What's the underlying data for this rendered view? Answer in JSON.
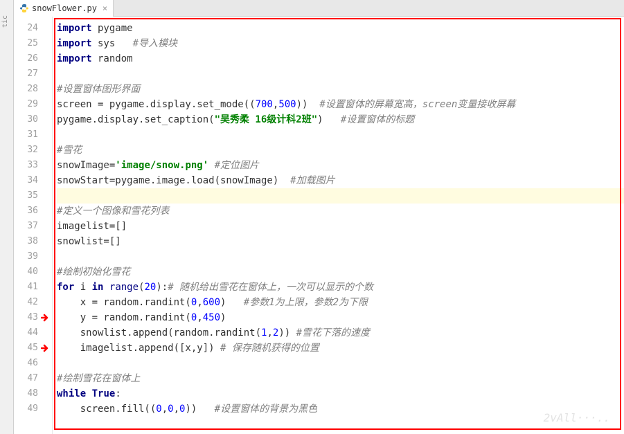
{
  "sidebar": {
    "label": "tic"
  },
  "tab": {
    "filename": "snowFlower.py"
  },
  "gutter": {
    "start": 24,
    "end": 49,
    "arrows": [
      43,
      45
    ]
  },
  "code": {
    "lines": [
      {
        "n": 24,
        "parts": [
          {
            "t": "import",
            "c": "kw"
          },
          {
            "t": " pygame",
            "c": ""
          }
        ]
      },
      {
        "n": 25,
        "parts": [
          {
            "t": "import",
            "c": "kw"
          },
          {
            "t": " sys   ",
            "c": ""
          },
          {
            "t": "#导入模块",
            "c": "com"
          }
        ]
      },
      {
        "n": 26,
        "parts": [
          {
            "t": "import",
            "c": "kw"
          },
          {
            "t": " random",
            "c": ""
          }
        ]
      },
      {
        "n": 27,
        "parts": []
      },
      {
        "n": 28,
        "parts": [
          {
            "t": "#设置窗体图形界面",
            "c": "com"
          }
        ]
      },
      {
        "n": 29,
        "parts": [
          {
            "t": "screen = pygame.display.set_mode((",
            "c": ""
          },
          {
            "t": "700",
            "c": "num"
          },
          {
            "t": ",",
            "c": ""
          },
          {
            "t": "500",
            "c": "num"
          },
          {
            "t": "))  ",
            "c": ""
          },
          {
            "t": "#设置窗体的屏幕宽高，",
            "c": "com"
          },
          {
            "t": "screen",
            "c": "com-em"
          },
          {
            "t": "变量接收屏幕",
            "c": "com"
          }
        ]
      },
      {
        "n": 30,
        "parts": [
          {
            "t": "pygame.display.set_caption(",
            "c": ""
          },
          {
            "t": "\"吴秀柔 16级计科2班\"",
            "c": "str"
          },
          {
            "t": ")   ",
            "c": ""
          },
          {
            "t": "#设置窗体的标题",
            "c": "com"
          }
        ]
      },
      {
        "n": 31,
        "parts": []
      },
      {
        "n": 32,
        "parts": [
          {
            "t": "#雪花",
            "c": "com"
          }
        ]
      },
      {
        "n": 33,
        "parts": [
          {
            "t": "snowImage=",
            "c": ""
          },
          {
            "t": "'image/snow.png'",
            "c": "str"
          },
          {
            "t": " ",
            "c": ""
          },
          {
            "t": "#定位图片",
            "c": "com"
          }
        ]
      },
      {
        "n": 34,
        "parts": [
          {
            "t": "snowStart=pygame.image.load(snowImage)  ",
            "c": ""
          },
          {
            "t": "#加载图片",
            "c": "com"
          }
        ]
      },
      {
        "n": 35,
        "parts": [],
        "hl": true
      },
      {
        "n": 36,
        "parts": [
          {
            "t": "#定义一个图像和雪花列表",
            "c": "com"
          }
        ]
      },
      {
        "n": 37,
        "parts": [
          {
            "t": "imagelist=[]",
            "c": ""
          }
        ]
      },
      {
        "n": 38,
        "parts": [
          {
            "t": "snowlist=[]",
            "c": ""
          }
        ]
      },
      {
        "n": 39,
        "parts": []
      },
      {
        "n": 40,
        "parts": [
          {
            "t": "#绘制初始化雪花",
            "c": "com"
          }
        ]
      },
      {
        "n": 41,
        "parts": [
          {
            "t": "for",
            "c": "kw"
          },
          {
            "t": " i ",
            "c": ""
          },
          {
            "t": "in",
            "c": "kw"
          },
          {
            "t": " ",
            "c": ""
          },
          {
            "t": "range",
            "c": "builtin"
          },
          {
            "t": "(",
            "c": ""
          },
          {
            "t": "20",
            "c": "num"
          },
          {
            "t": "):",
            "c": ""
          },
          {
            "t": "# 随机给出雪花在窗体上，一次可以显示的个数",
            "c": "com"
          }
        ]
      },
      {
        "n": 42,
        "parts": [
          {
            "t": "    x = random.randint(",
            "c": ""
          },
          {
            "t": "0",
            "c": "num"
          },
          {
            "t": ",",
            "c": ""
          },
          {
            "t": "600",
            "c": "num"
          },
          {
            "t": ")   ",
            "c": ""
          },
          {
            "t": "#参数1为上限，参数2为下限",
            "c": "com"
          }
        ]
      },
      {
        "n": 43,
        "parts": [
          {
            "t": "    y = random.randint(",
            "c": ""
          },
          {
            "t": "0",
            "c": "num"
          },
          {
            "t": ",",
            "c": ""
          },
          {
            "t": "450",
            "c": "num"
          },
          {
            "t": ")",
            "c": ""
          }
        ]
      },
      {
        "n": 44,
        "parts": [
          {
            "t": "    snowlist.append(random.randint(",
            "c": ""
          },
          {
            "t": "1",
            "c": "num"
          },
          {
            "t": ",",
            "c": ""
          },
          {
            "t": "2",
            "c": "num"
          },
          {
            "t": ")) ",
            "c": ""
          },
          {
            "t": "#雪花下落的速度",
            "c": "com"
          }
        ]
      },
      {
        "n": 45,
        "parts": [
          {
            "t": "    imagelist.append([x,y]) ",
            "c": ""
          },
          {
            "t": "# 保存随机获得的位置",
            "c": "com"
          }
        ]
      },
      {
        "n": 46,
        "parts": []
      },
      {
        "n": 47,
        "parts": [
          {
            "t": "#绘制雪花在窗体上",
            "c": "com"
          }
        ]
      },
      {
        "n": 48,
        "parts": [
          {
            "t": "while",
            "c": "kw"
          },
          {
            "t": " ",
            "c": ""
          },
          {
            "t": "True",
            "c": "kw"
          },
          {
            "t": ":",
            "c": ""
          }
        ]
      },
      {
        "n": 49,
        "parts": [
          {
            "t": "    screen.fill((",
            "c": ""
          },
          {
            "t": "0",
            "c": "num"
          },
          {
            "t": ",",
            "c": ""
          },
          {
            "t": "0",
            "c": "num"
          },
          {
            "t": ",",
            "c": ""
          },
          {
            "t": "0",
            "c": "num"
          },
          {
            "t": "))   ",
            "c": ""
          },
          {
            "t": "#设置窗体的背景为黑色",
            "c": "com"
          }
        ]
      }
    ]
  },
  "watermark": "2vAll···.."
}
